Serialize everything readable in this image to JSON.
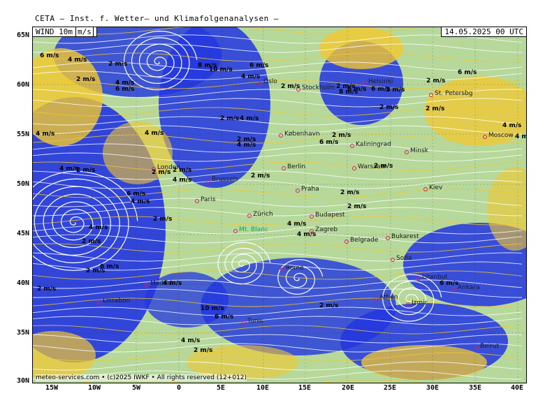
{
  "header": {
    "title": "CETA — Inst. f. Wetter— und Klimafolgenanalysen —"
  },
  "panel": {
    "field": "WIND 10m",
    "unit": "m/s",
    "valid_time": "14.05.2025 00 UTC"
  },
  "credit": "meteo-services.com • (c)2025 IWKF • All rights reserved (12+012)",
  "axes": {
    "lat_ticks": [
      "65N",
      "60N",
      "55N",
      "50N",
      "45N",
      "40N",
      "35N",
      "30N"
    ],
    "lon_ticks": [
      "15W",
      "10W",
      "5W",
      "0",
      "5E",
      "10E",
      "15E",
      "20E",
      "25E",
      "30E",
      "35E",
      "40E"
    ]
  },
  "colors": {
    "fast_wind": "#2236e0",
    "moderate_wind": "#f2c830",
    "light_wind": "#b6d89a",
    "streamline": "#ffffff"
  },
  "cities": [
    {
      "name": "Oslo"
    },
    {
      "name": "Stockholm"
    },
    {
      "name": "Helsinki"
    },
    {
      "name": "St. Petersbg"
    },
    {
      "name": "København"
    },
    {
      "name": "Kaliningrad"
    },
    {
      "name": "Minsk"
    },
    {
      "name": "Moscow"
    },
    {
      "name": "London"
    },
    {
      "name": "Berlin"
    },
    {
      "name": "Warszaw"
    },
    {
      "name": "Brussels"
    },
    {
      "name": "Praha"
    },
    {
      "name": "Kiev"
    },
    {
      "name": "Paris"
    },
    {
      "name": "Zürich"
    },
    {
      "name": "Budapest"
    },
    {
      "name": "Mt. Blanc"
    },
    {
      "name": "Zagreb"
    },
    {
      "name": "Bukarest"
    },
    {
      "name": "Belgrade"
    },
    {
      "name": "Sofia"
    },
    {
      "name": "Rome"
    },
    {
      "name": "Madrid"
    },
    {
      "name": "Istanbul"
    },
    {
      "name": "Ankara"
    },
    {
      "name": "Lissabon"
    },
    {
      "name": "Athen"
    },
    {
      "name": "Izmir"
    },
    {
      "name": "Tunis"
    },
    {
      "name": "Beirut"
    }
  ],
  "speed_labels": [
    "6 m/s",
    "4 m/s",
    "2 m/s",
    "2 m/s",
    "4 m/s",
    "6 m/s",
    "8 m/s",
    "10 m/s",
    "6 m/s",
    "4 m/s",
    "4 m/s",
    "2 m/s",
    "8 m/s",
    "4 m/s",
    "2 m/s",
    "4 m/s",
    "2 m/s",
    "4 m/s",
    "2 m/s",
    "6 m/s",
    "6 m/s",
    "2 m/s",
    "2 m/s",
    "4 m/s",
    "4 m/s",
    "6 m/s",
    "2 m/s",
    "2 m/s",
    "2 m/s",
    "6 m/s",
    "4 m/s",
    "2 m/s",
    "2 m/s",
    "2 m/s",
    "4 m/s",
    "2 m/s",
    "2 m/s",
    "2 m/s",
    "6 m/s",
    "4 m/s",
    "2 m/s",
    "4 m/s",
    "2 m/s",
    "2 m/s",
    "4 m/s",
    "4 m/s",
    "2 m/s",
    "6 m/s",
    "2 m/s",
    "4 m/s",
    "6 m/s",
    "10 m/s",
    "6 m/s",
    "2 m/s",
    "4 m/s",
    "2 m/s"
  ]
}
